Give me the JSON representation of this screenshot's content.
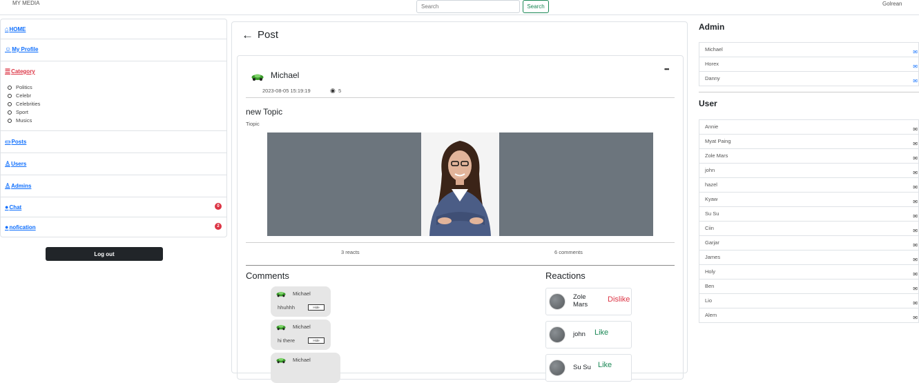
{
  "topbar": {
    "brand": "MY MEDIA",
    "search_placeholder": "Search",
    "search_button": "Search",
    "username": "Golrean"
  },
  "sidebar": {
    "items": [
      {
        "label": "HOME",
        "icon": "house-icon"
      },
      {
        "label": "My Profile",
        "icon": "person-circle-icon"
      },
      {
        "label": "Category",
        "icon": "list-icon"
      },
      {
        "label": "Posts",
        "icon": "window-icon"
      },
      {
        "label": "Users",
        "icon": "person-icon"
      },
      {
        "label": "Admins",
        "icon": "person-gear-icon"
      },
      {
        "label": "Chat",
        "icon": "chat-icon",
        "badge": "0"
      },
      {
        "label": "nofication",
        "icon": "info-icon",
        "badge": "2"
      }
    ],
    "categories": [
      "Politics",
      "Celebr",
      "Celebrities",
      "Sport",
      "Musics"
    ],
    "logout": "Log out"
  },
  "main": {
    "heading": "Post",
    "post": {
      "author": "Michael",
      "date": "2023-08-05 15:19:19",
      "views": "5",
      "title": "new Topic",
      "subtitle": "Tiopic",
      "reacts": "3 reacts",
      "comments": "6 comments"
    },
    "comments_title": "Comments",
    "reactions_title": "Reactions",
    "comments": [
      {
        "author": "Michael",
        "text": "hhuhhh",
        "hide": "Hide"
      },
      {
        "author": "Michael",
        "text": "hi there",
        "hide": "Hide"
      },
      {
        "author": "Michael",
        "text": "",
        "hide": ""
      }
    ],
    "reactions": [
      {
        "name_line1": "Zole",
        "name_line2": "Mars",
        "type": "Dislike"
      },
      {
        "name_line1": "john",
        "name_line2": "",
        "type": "Like"
      },
      {
        "name_line1": "Su Su",
        "name_line2": "",
        "type": "Like"
      }
    ]
  },
  "right": {
    "admin_title": "Admin",
    "admins": [
      "Michael",
      "Horex",
      "Danny"
    ],
    "user_title": "User",
    "users": [
      "Annie",
      "Myat Paing",
      "Zole Mars",
      "john",
      "hazel",
      "Kyaw",
      "Su Su",
      "Ciin",
      "Garjar",
      "James",
      "Holy",
      "Ben",
      "Lio",
      "Alem"
    ]
  },
  "colors": {
    "link": "#0d6efd",
    "category": "#dc3545",
    "like": "#198754",
    "dislike": "#dc3545",
    "image_bg": "#6c757d"
  }
}
